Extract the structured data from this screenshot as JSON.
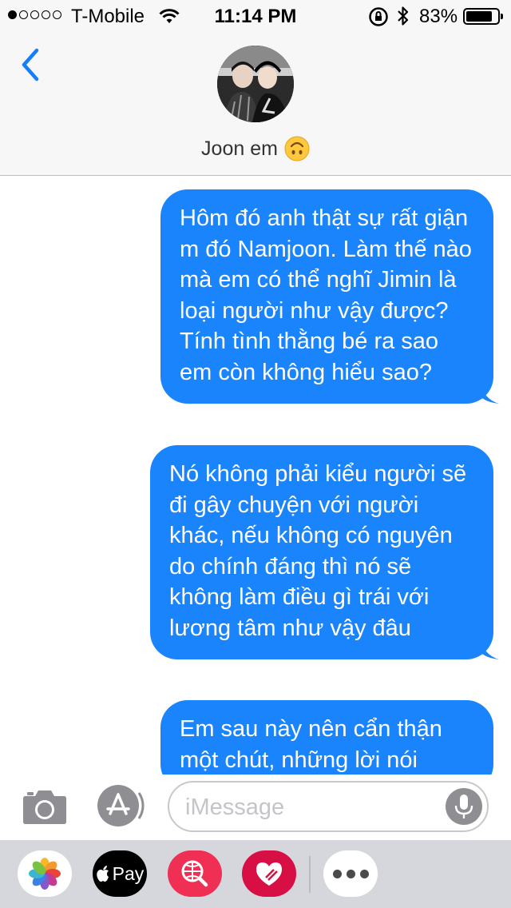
{
  "status_bar": {
    "carrier": "T-Mobile",
    "time": "11:14 PM",
    "battery_percent": "83%",
    "battery_level": 0.83,
    "signal_strength": 1,
    "signal_max": 5
  },
  "header": {
    "back_icon": "chevron-left-icon",
    "contact_name": "Joon em",
    "contact_emoji": "upside-down-face"
  },
  "messages": [
    {
      "direction": "sent",
      "text": "Hôm đó anh thật sự rất giận m đó Namjoon. Làm thế nào mà em có thể nghĩ Jimin là loại người như vậy được? Tính tình thằng bé ra sao em còn không hiểu sao?"
    },
    {
      "direction": "sent",
      "text": "Nó không phải kiểu người sẽ đi gây chuyện với người khác, nếu không có nguyên do chính đáng thì nó sẽ không làm điều gì trái với lương tâm như vậy đâu"
    },
    {
      "direction": "sent",
      "text": "Em sau này nên cẩn thận một chút, những lời nói"
    }
  ],
  "input_bar": {
    "camera_icon": "camera-icon",
    "appstore_icon": "app-store-icon",
    "placeholder": "iMessage",
    "value": "",
    "mic_icon": "microphone-icon"
  },
  "app_drawer": {
    "apple_pay_label": "Pay",
    "apps": [
      "photos-app-icon",
      "apple-pay-app-icon",
      "search-images-app-icon",
      "digital-touch-app-icon",
      "more-apps-icon"
    ]
  },
  "colors": {
    "bubble_blue": "#1a84fc",
    "tint_blue": "#157efb",
    "bar_background": "#f7f7f7",
    "drawer_background": "#d5d7dd"
  }
}
